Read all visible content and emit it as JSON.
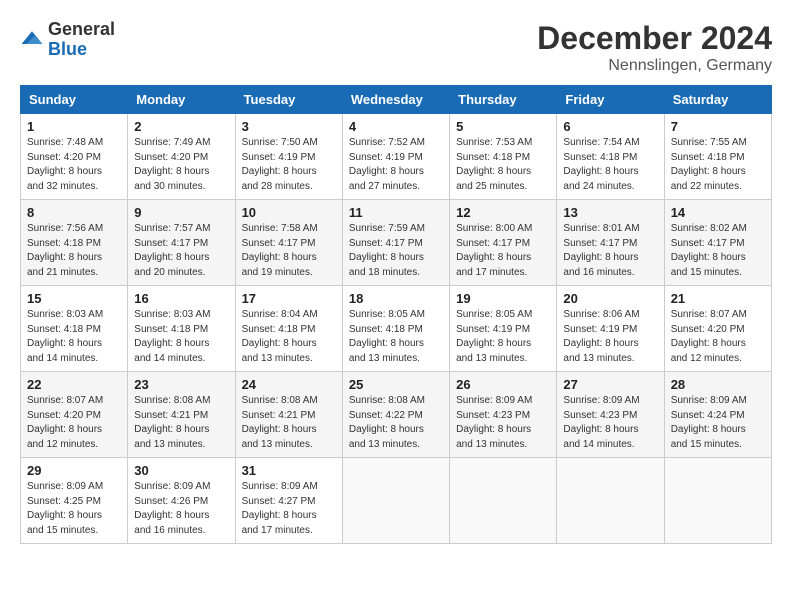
{
  "header": {
    "logo_general": "General",
    "logo_blue": "Blue",
    "month": "December 2024",
    "location": "Nennslingen, Germany"
  },
  "weekdays": [
    "Sunday",
    "Monday",
    "Tuesday",
    "Wednesday",
    "Thursday",
    "Friday",
    "Saturday"
  ],
  "weeks": [
    [
      {
        "day": "1",
        "sunrise": "7:48 AM",
        "sunset": "4:20 PM",
        "daylight": "8 hours and 32 minutes."
      },
      {
        "day": "2",
        "sunrise": "7:49 AM",
        "sunset": "4:20 PM",
        "daylight": "8 hours and 30 minutes."
      },
      {
        "day": "3",
        "sunrise": "7:50 AM",
        "sunset": "4:19 PM",
        "daylight": "8 hours and 28 minutes."
      },
      {
        "day": "4",
        "sunrise": "7:52 AM",
        "sunset": "4:19 PM",
        "daylight": "8 hours and 27 minutes."
      },
      {
        "day": "5",
        "sunrise": "7:53 AM",
        "sunset": "4:18 PM",
        "daylight": "8 hours and 25 minutes."
      },
      {
        "day": "6",
        "sunrise": "7:54 AM",
        "sunset": "4:18 PM",
        "daylight": "8 hours and 24 minutes."
      },
      {
        "day": "7",
        "sunrise": "7:55 AM",
        "sunset": "4:18 PM",
        "daylight": "8 hours and 22 minutes."
      }
    ],
    [
      {
        "day": "8",
        "sunrise": "7:56 AM",
        "sunset": "4:18 PM",
        "daylight": "8 hours and 21 minutes."
      },
      {
        "day": "9",
        "sunrise": "7:57 AM",
        "sunset": "4:17 PM",
        "daylight": "8 hours and 20 minutes."
      },
      {
        "day": "10",
        "sunrise": "7:58 AM",
        "sunset": "4:17 PM",
        "daylight": "8 hours and 19 minutes."
      },
      {
        "day": "11",
        "sunrise": "7:59 AM",
        "sunset": "4:17 PM",
        "daylight": "8 hours and 18 minutes."
      },
      {
        "day": "12",
        "sunrise": "8:00 AM",
        "sunset": "4:17 PM",
        "daylight": "8 hours and 17 minutes."
      },
      {
        "day": "13",
        "sunrise": "8:01 AM",
        "sunset": "4:17 PM",
        "daylight": "8 hours and 16 minutes."
      },
      {
        "day": "14",
        "sunrise": "8:02 AM",
        "sunset": "4:17 PM",
        "daylight": "8 hours and 15 minutes."
      }
    ],
    [
      {
        "day": "15",
        "sunrise": "8:03 AM",
        "sunset": "4:18 PM",
        "daylight": "8 hours and 14 minutes."
      },
      {
        "day": "16",
        "sunrise": "8:03 AM",
        "sunset": "4:18 PM",
        "daylight": "8 hours and 14 minutes."
      },
      {
        "day": "17",
        "sunrise": "8:04 AM",
        "sunset": "4:18 PM",
        "daylight": "8 hours and 13 minutes."
      },
      {
        "day": "18",
        "sunrise": "8:05 AM",
        "sunset": "4:18 PM",
        "daylight": "8 hours and 13 minutes."
      },
      {
        "day": "19",
        "sunrise": "8:05 AM",
        "sunset": "4:19 PM",
        "daylight": "8 hours and 13 minutes."
      },
      {
        "day": "20",
        "sunrise": "8:06 AM",
        "sunset": "4:19 PM",
        "daylight": "8 hours and 13 minutes."
      },
      {
        "day": "21",
        "sunrise": "8:07 AM",
        "sunset": "4:20 PM",
        "daylight": "8 hours and 12 minutes."
      }
    ],
    [
      {
        "day": "22",
        "sunrise": "8:07 AM",
        "sunset": "4:20 PM",
        "daylight": "8 hours and 12 minutes."
      },
      {
        "day": "23",
        "sunrise": "8:08 AM",
        "sunset": "4:21 PM",
        "daylight": "8 hours and 13 minutes."
      },
      {
        "day": "24",
        "sunrise": "8:08 AM",
        "sunset": "4:21 PM",
        "daylight": "8 hours and 13 minutes."
      },
      {
        "day": "25",
        "sunrise": "8:08 AM",
        "sunset": "4:22 PM",
        "daylight": "8 hours and 13 minutes."
      },
      {
        "day": "26",
        "sunrise": "8:09 AM",
        "sunset": "4:23 PM",
        "daylight": "8 hours and 13 minutes."
      },
      {
        "day": "27",
        "sunrise": "8:09 AM",
        "sunset": "4:23 PM",
        "daylight": "8 hours and 14 minutes."
      },
      {
        "day": "28",
        "sunrise": "8:09 AM",
        "sunset": "4:24 PM",
        "daylight": "8 hours and 15 minutes."
      }
    ],
    [
      {
        "day": "29",
        "sunrise": "8:09 AM",
        "sunset": "4:25 PM",
        "daylight": "8 hours and 15 minutes."
      },
      {
        "day": "30",
        "sunrise": "8:09 AM",
        "sunset": "4:26 PM",
        "daylight": "8 hours and 16 minutes."
      },
      {
        "day": "31",
        "sunrise": "8:09 AM",
        "sunset": "4:27 PM",
        "daylight": "8 hours and 17 minutes."
      },
      null,
      null,
      null,
      null
    ]
  ],
  "labels": {
    "sunrise": "Sunrise:",
    "sunset": "Sunset:",
    "daylight": "Daylight:"
  }
}
